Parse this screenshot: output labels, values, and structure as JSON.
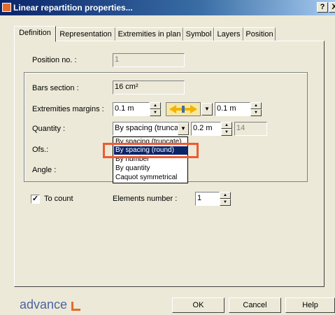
{
  "window": {
    "title": "Linear repartition properties...",
    "help_label": "?",
    "close_label": "X"
  },
  "tabs": [
    {
      "label": "Definition",
      "active": true
    },
    {
      "label": "Representation"
    },
    {
      "label": "Extremities in plan"
    },
    {
      "label": "Symbol"
    },
    {
      "label": "Layers"
    },
    {
      "label": "Position"
    }
  ],
  "form": {
    "position_label": "Position no. :",
    "position_value": "1",
    "bars_section_label": "Bars section :",
    "bars_section_value": "16 cm²",
    "extremities_margins_label": "Extremities margins :",
    "margin_left_value": "0.1 m",
    "margin_right_value": "0.1 m",
    "quantity_label": "Quantity :",
    "quantity_selected": "By spacing (truncate)",
    "spacing_value": "0.2 m",
    "count_value": "14",
    "ofs_label": "Ofs.:",
    "angle_label": "Angle :",
    "to_count_label": "To count",
    "to_count_checked": true,
    "elements_number_label": "Elements number :",
    "elements_number_value": "1"
  },
  "quantity_options": [
    "By spacing (truncate)",
    "By spacing (round)",
    "By number",
    "By quantity",
    "Caquot symmetrical"
  ],
  "quantity_highlighted_index": 1,
  "footer": {
    "brand": "advance",
    "ok_label": "OK",
    "cancel_label": "Cancel",
    "help_label": "Help"
  },
  "colors": {
    "highlight": "#ef5a2f",
    "title_bar": "#0a246a",
    "selection": "#0a246a",
    "brand": "#4d63a0"
  }
}
